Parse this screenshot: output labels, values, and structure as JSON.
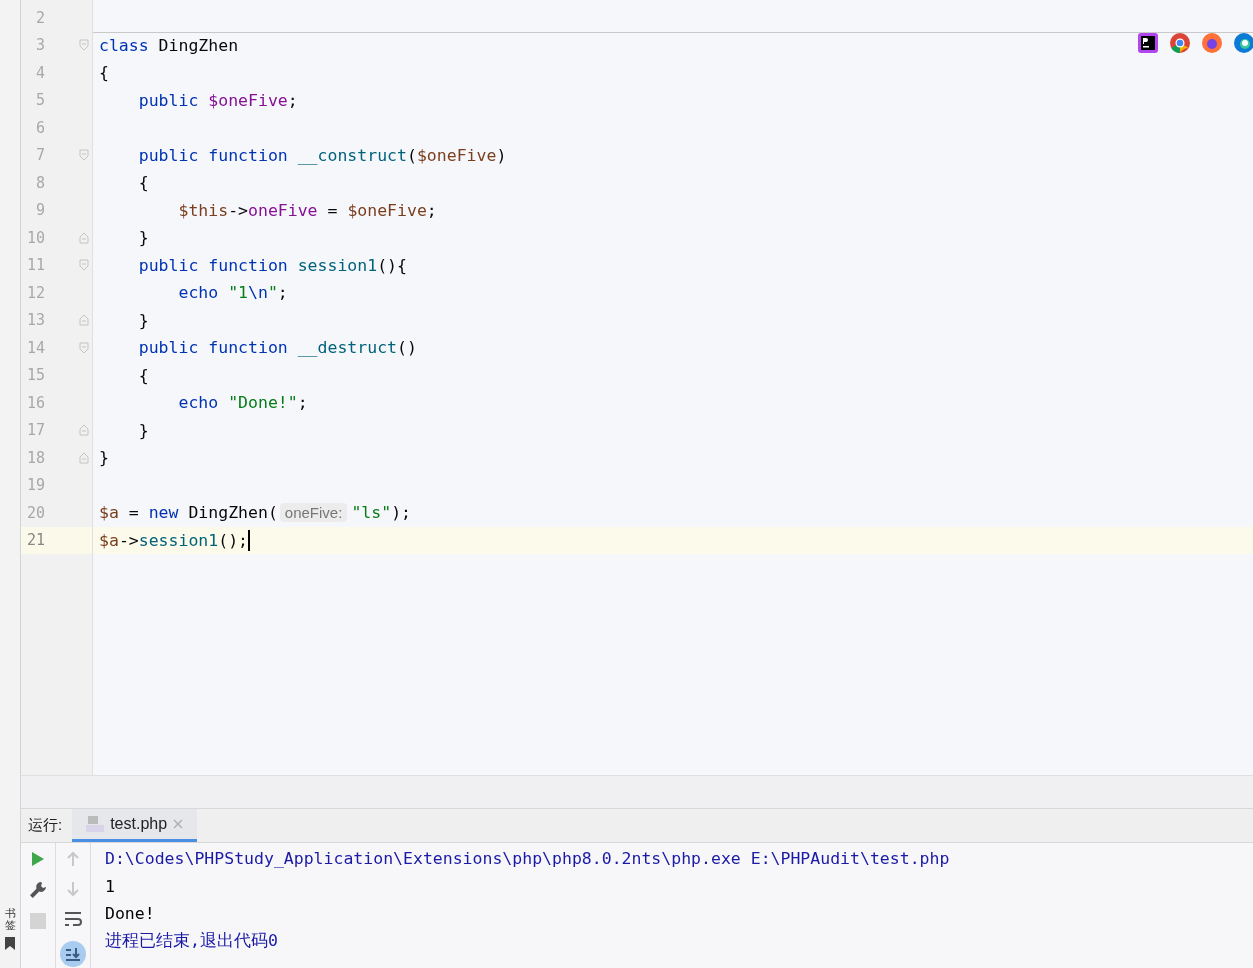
{
  "editor": {
    "lines": [
      {
        "number": "2",
        "current": false
      },
      {
        "number": "3",
        "current": false,
        "separator_above": true,
        "fold_start": true,
        "tokens": [
          {
            "text": "class ",
            "kind": "keyword"
          },
          {
            "text": "DingZhen",
            "kind": "plain"
          }
        ]
      },
      {
        "number": "4",
        "current": false,
        "tokens": [
          {
            "text": "{",
            "kind": "plain"
          }
        ]
      },
      {
        "number": "5",
        "current": false,
        "tokens": [
          {
            "text": "    public ",
            "kind": "keyword"
          },
          {
            "text": "$oneFive",
            "kind": "field"
          },
          {
            "text": ";",
            "kind": "plain"
          }
        ]
      },
      {
        "number": "6",
        "current": false
      },
      {
        "number": "7",
        "current": false,
        "fold_start": true,
        "tokens": [
          {
            "text": "    public function ",
            "kind": "keyword"
          },
          {
            "text": "__construct",
            "kind": "func"
          },
          {
            "text": "(",
            "kind": "plain"
          },
          {
            "text": "$oneFive",
            "kind": "var"
          },
          {
            "text": ")",
            "kind": "plain"
          }
        ]
      },
      {
        "number": "8",
        "current": false,
        "tokens": [
          {
            "text": "    {",
            "kind": "plain"
          }
        ]
      },
      {
        "number": "9",
        "current": false,
        "tokens": [
          {
            "text": "        $this",
            "kind": "var"
          },
          {
            "text": "->",
            "kind": "plain"
          },
          {
            "text": "oneFive",
            "kind": "field"
          },
          {
            "text": " = ",
            "kind": "plain"
          },
          {
            "text": "$oneFive",
            "kind": "var"
          },
          {
            "text": ";",
            "kind": "plain"
          }
        ]
      },
      {
        "number": "10",
        "current": false,
        "fold_end": true,
        "tokens": [
          {
            "text": "    }",
            "kind": "plain"
          }
        ]
      },
      {
        "number": "11",
        "current": false,
        "fold_start": true,
        "tokens": [
          {
            "text": "    public function ",
            "kind": "keyword"
          },
          {
            "text": "session1",
            "kind": "func"
          },
          {
            "text": "(){",
            "kind": "plain"
          }
        ]
      },
      {
        "number": "12",
        "current": false,
        "tokens": [
          {
            "text": "        echo ",
            "kind": "keyword"
          },
          {
            "text": "\"1",
            "kind": "string"
          },
          {
            "text": "\\n",
            "kind": "keyword"
          },
          {
            "text": "\"",
            "kind": "string"
          },
          {
            "text": ";",
            "kind": "plain"
          }
        ]
      },
      {
        "number": "13",
        "current": false,
        "fold_end": true,
        "tokens": [
          {
            "text": "    }",
            "kind": "plain"
          }
        ]
      },
      {
        "number": "14",
        "current": false,
        "fold_start": true,
        "tokens": [
          {
            "text": "    public function ",
            "kind": "keyword"
          },
          {
            "text": "__destruct",
            "kind": "func"
          },
          {
            "text": "()",
            "kind": "plain"
          }
        ]
      },
      {
        "number": "15",
        "current": false,
        "tokens": [
          {
            "text": "    {",
            "kind": "plain"
          }
        ]
      },
      {
        "number": "16",
        "current": false,
        "tokens": [
          {
            "text": "        echo ",
            "kind": "keyword"
          },
          {
            "text": "\"Done!\"",
            "kind": "string"
          },
          {
            "text": ";",
            "kind": "plain"
          }
        ]
      },
      {
        "number": "17",
        "current": false,
        "fold_end": true,
        "tokens": [
          {
            "text": "    }",
            "kind": "plain"
          }
        ]
      },
      {
        "number": "18",
        "current": false,
        "fold_end": true,
        "tokens": [
          {
            "text": "}",
            "kind": "plain"
          }
        ]
      },
      {
        "number": "19",
        "current": false
      },
      {
        "number": "20",
        "current": false,
        "tokens": [
          {
            "text": "$a",
            "kind": "var"
          },
          {
            "text": " = ",
            "kind": "plain"
          },
          {
            "text": "new ",
            "kind": "keyword"
          },
          {
            "text": "DingZhen(",
            "kind": "plain"
          },
          {
            "text": "oneFive:",
            "kind": "hint"
          },
          {
            "text": "\"ls\"",
            "kind": "string"
          },
          {
            "text": ");",
            "kind": "plain"
          }
        ]
      },
      {
        "number": "21",
        "current": true,
        "tokens": [
          {
            "text": "$a",
            "kind": "var"
          },
          {
            "text": "->",
            "kind": "plain"
          },
          {
            "text": "session1",
            "kind": "func"
          },
          {
            "text": "();",
            "kind": "plain"
          }
        ]
      }
    ]
  },
  "run_panel": {
    "label": "运行:",
    "tabs": [
      {
        "label": "test.php",
        "selected": true
      }
    ],
    "output": [
      "D:\\Codes\\PHPStudy_Application\\Extensions\\php\\php8.0.2nts\\php.exe E:\\PHPAudit\\test.php",
      "1",
      "Done!",
      "进程已结束,退出代码0"
    ]
  },
  "side_strip": {
    "label": "书签"
  }
}
